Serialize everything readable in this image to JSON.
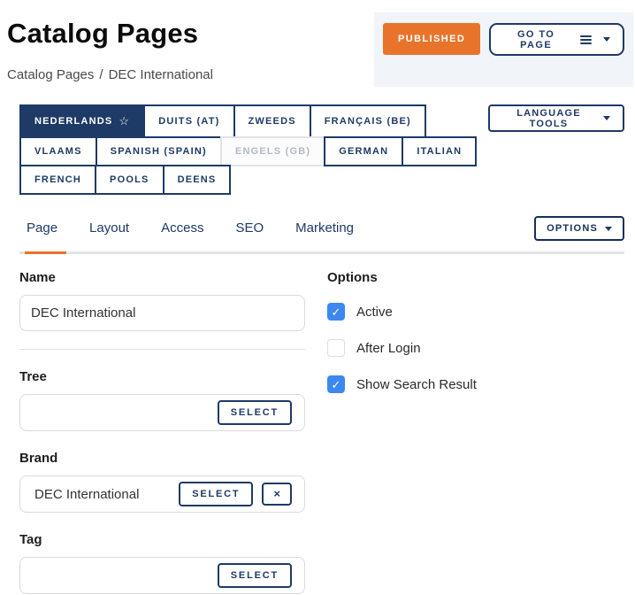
{
  "page": {
    "title": "Catalog Pages"
  },
  "breadcrumb": {
    "root": "Catalog Pages",
    "separator": "/",
    "current": "DEC International"
  },
  "header": {
    "published_label": "PUBLISHED",
    "go_to_page_label": "GO TO PAGE"
  },
  "languages": {
    "tools_label": "LANGUAGE TOOLS",
    "star_icon": "☆",
    "tabs": [
      {
        "label": "NEDERLANDS",
        "active": true,
        "starred": true,
        "disabled": false
      },
      {
        "label": "DUITS (AT)",
        "active": false,
        "starred": false,
        "disabled": false
      },
      {
        "label": "ZWEEDS",
        "active": false,
        "starred": false,
        "disabled": false
      },
      {
        "label": "FRANÇAIS (BE)",
        "active": false,
        "starred": false,
        "disabled": false
      },
      {
        "label": "VLAAMS",
        "active": false,
        "starred": false,
        "disabled": false
      },
      {
        "label": "SPANISH (SPAIN)",
        "active": false,
        "starred": false,
        "disabled": false
      },
      {
        "label": "ENGELS (GB)",
        "active": false,
        "starred": false,
        "disabled": true
      },
      {
        "label": "GERMAN",
        "active": false,
        "starred": false,
        "disabled": false
      },
      {
        "label": "ITALIAN",
        "active": false,
        "starred": false,
        "disabled": false
      },
      {
        "label": "FRENCH",
        "active": false,
        "starred": false,
        "disabled": false
      },
      {
        "label": "POOLS",
        "active": false,
        "starred": false,
        "disabled": false
      },
      {
        "label": "DEENS",
        "active": false,
        "starred": false,
        "disabled": false
      }
    ]
  },
  "tabs": {
    "items": [
      {
        "label": "Page",
        "active": true
      },
      {
        "label": "Layout",
        "active": false
      },
      {
        "label": "Access",
        "active": false
      },
      {
        "label": "SEO",
        "active": false
      },
      {
        "label": "Marketing",
        "active": false
      }
    ],
    "options_label": "OPTIONS"
  },
  "form": {
    "name": {
      "label": "Name",
      "value": "DEC International"
    },
    "tree": {
      "label": "Tree",
      "value": "",
      "select_label": "SELECT"
    },
    "brand": {
      "label": "Brand",
      "value": "DEC International",
      "select_label": "SELECT",
      "clear_icon": "×"
    },
    "tag": {
      "label": "Tag",
      "value": "",
      "select_label": "SELECT"
    }
  },
  "options_panel": {
    "title": "Options",
    "check_icon": "✓",
    "checkboxes": [
      {
        "label": "Active",
        "checked": true
      },
      {
        "label": "After Login",
        "checked": false
      },
      {
        "label": "Show Search Result",
        "checked": true
      }
    ]
  },
  "colors": {
    "navy": "#1e3a66",
    "orange": "#e8742c",
    "checkbox_blue": "#3d87f0",
    "panel_bg": "#f1f5f9",
    "active_tab_underline": "#e8742c"
  }
}
